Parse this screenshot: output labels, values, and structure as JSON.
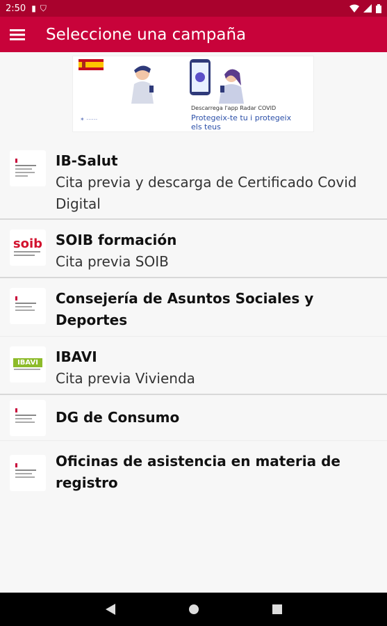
{
  "status_bar": {
    "time": "2:50"
  },
  "app_bar": {
    "title": "Seleccione una campaña"
  },
  "banner": {
    "line1": "Descarrega l'app Radar COVID",
    "line2a": "Protegeix-te tu i protegeix",
    "line2b": "els teus"
  },
  "items": [
    {
      "title": "IB-Salut",
      "subtitle": "Cita previa y descarga de Certificado Covid Digital",
      "icon": "ib-salut-logo-icon"
    },
    {
      "title": "SOIB formación",
      "subtitle": "Cita previa SOIB",
      "icon": "soib-logo-icon",
      "logo_text": "soib"
    },
    {
      "title": "Consejería de Asuntos Sociales y Deportes",
      "subtitle": "",
      "icon": "govern-logo-icon"
    },
    {
      "title": "IBAVI",
      "subtitle": "Cita previa Vivienda",
      "icon": "ibavi-logo-icon",
      "logo_text": "IBAVI"
    },
    {
      "title": "DG de Consumo",
      "subtitle": "",
      "icon": "govern-logo-icon"
    },
    {
      "title": "Oficinas de asistencia en materia de registro",
      "subtitle": "",
      "icon": "govern-logo-icon"
    }
  ],
  "colors": {
    "status_bar": "#a9022d",
    "app_bar": "#c8033a",
    "soib_red": "#d2122e",
    "ibavi_green": "#8dbb2a"
  }
}
